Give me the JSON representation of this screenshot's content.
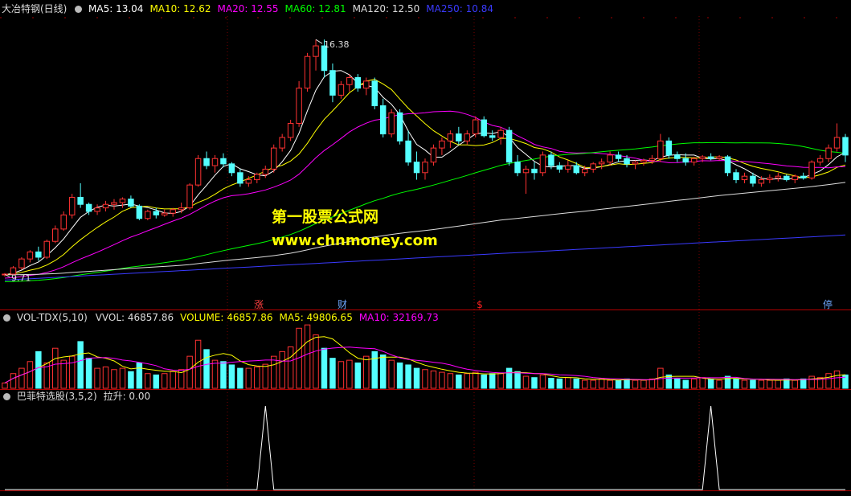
{
  "main_panel": {
    "title": "大冶特钢(日线)",
    "ma": [
      {
        "label": "MA5: 13.04",
        "color": "#ffffff"
      },
      {
        "label": "MA10: 12.62",
        "color": "#ffff00"
      },
      {
        "label": "MA20: 12.55",
        "color": "#ff00ff"
      },
      {
        "label": "MA60: 12.81",
        "color": "#00ff00"
      },
      {
        "label": "MA120: 12.50",
        "color": "#dddddd"
      },
      {
        "label": "MA250: 10.84",
        "color": "#3a3aff"
      }
    ],
    "high_label": "16.38",
    "low_label": "9.71",
    "markers": [
      {
        "text": "涨",
        "color": "#ff4040"
      },
      {
        "text": "财",
        "color": "#6fa8ff"
      },
      {
        "text": "$",
        "color": "#ff2020"
      },
      {
        "text": "停",
        "color": "#6fa8ff"
      }
    ]
  },
  "volume_panel": {
    "name": "VOL-TDX(5,10)",
    "labels": [
      {
        "text": "VVOL: 46857.86",
        "color": "#dddddd"
      },
      {
        "text": "VOLUME: 46857.86",
        "color": "#ffff00"
      },
      {
        "text": "MA5: 49806.65",
        "color": "#ffff00"
      },
      {
        "text": "MA10: 32169.73",
        "color": "#ff00ff"
      }
    ]
  },
  "indicator_panel": {
    "name": "巴菲特选股(3,5,2)",
    "value_label": "拉升: 0.00"
  },
  "watermark": {
    "line1": "第一股票公式网",
    "line2": "www.chnmoney.com"
  },
  "colors": {
    "up": "#ff3232",
    "down": "#54ffff",
    "ma5": "#ffffff",
    "ma10": "#ffff00",
    "ma20": "#ff00ff",
    "ma60": "#00ff00",
    "ma120": "#dddddd",
    "ma250": "#3a3aff",
    "separator": "#b00000"
  },
  "chart_data": {
    "type": "candlestick",
    "price_range": [
      9.4,
      17.0
    ],
    "candles": [
      [
        9.71,
        9.75,
        9.65,
        9.72
      ],
      [
        9.72,
        9.95,
        9.7,
        9.9
      ],
      [
        9.9,
        10.2,
        9.85,
        10.15
      ],
      [
        10.15,
        10.4,
        10.05,
        10.35
      ],
      [
        10.35,
        10.5,
        10.1,
        10.2
      ],
      [
        10.2,
        10.7,
        10.15,
        10.65
      ],
      [
        10.65,
        11.1,
        10.6,
        11.0
      ],
      [
        11.0,
        11.5,
        10.95,
        11.4
      ],
      [
        11.4,
        12.0,
        11.3,
        11.9
      ],
      [
        11.9,
        12.3,
        11.6,
        11.7
      ],
      [
        11.7,
        11.75,
        11.4,
        11.5
      ],
      [
        11.5,
        11.7,
        11.4,
        11.6
      ],
      [
        11.6,
        11.8,
        11.5,
        11.7
      ],
      [
        11.7,
        11.85,
        11.55,
        11.75
      ],
      [
        11.75,
        11.9,
        11.6,
        11.85
      ],
      [
        11.85,
        11.95,
        11.6,
        11.65
      ],
      [
        11.65,
        11.7,
        11.25,
        11.3
      ],
      [
        11.3,
        11.55,
        11.25,
        11.5
      ],
      [
        11.5,
        11.6,
        11.3,
        11.4
      ],
      [
        11.4,
        11.55,
        11.35,
        11.45
      ],
      [
        11.45,
        11.6,
        11.35,
        11.55
      ],
      [
        11.55,
        11.75,
        11.45,
        11.6
      ],
      [
        11.6,
        12.3,
        11.55,
        12.25
      ],
      [
        12.25,
        13.1,
        12.2,
        13.0
      ],
      [
        13.0,
        13.2,
        12.7,
        12.8
      ],
      [
        12.8,
        13.1,
        12.6,
        13.0
      ],
      [
        13.0,
        13.15,
        12.75,
        12.85
      ],
      [
        12.85,
        12.9,
        12.5,
        12.6
      ],
      [
        12.6,
        12.7,
        12.2,
        12.3
      ],
      [
        12.3,
        12.5,
        12.2,
        12.4
      ],
      [
        12.4,
        12.6,
        12.3,
        12.55
      ],
      [
        12.55,
        12.8,
        12.45,
        12.7
      ],
      [
        12.7,
        13.4,
        12.6,
        13.3
      ],
      [
        13.3,
        13.7,
        13.2,
        13.6
      ],
      [
        13.6,
        14.1,
        13.5,
        14.0
      ],
      [
        14.0,
        15.2,
        13.9,
        15.0
      ],
      [
        15.0,
        16.0,
        14.9,
        15.9
      ],
      [
        15.9,
        16.38,
        15.5,
        16.2
      ],
      [
        16.2,
        16.38,
        15.3,
        15.5
      ],
      [
        15.5,
        15.7,
        14.6,
        14.8
      ],
      [
        14.8,
        15.2,
        14.7,
        15.1
      ],
      [
        15.1,
        15.4,
        14.9,
        15.3
      ],
      [
        15.3,
        15.4,
        14.9,
        15.0
      ],
      [
        15.0,
        15.3,
        14.8,
        15.2
      ],
      [
        15.2,
        15.3,
        14.4,
        14.5
      ],
      [
        14.5,
        14.7,
        13.6,
        13.7
      ],
      [
        13.7,
        14.4,
        13.6,
        14.3
      ],
      [
        14.3,
        14.4,
        13.4,
        13.5
      ],
      [
        13.5,
        13.8,
        12.8,
        12.9
      ],
      [
        12.9,
        13.2,
        12.4,
        12.6
      ],
      [
        12.6,
        13.0,
        12.4,
        12.9
      ],
      [
        12.9,
        13.4,
        12.8,
        13.3
      ],
      [
        13.3,
        13.6,
        13.1,
        13.5
      ],
      [
        13.5,
        13.8,
        13.3,
        13.7
      ],
      [
        13.7,
        13.9,
        13.4,
        13.5
      ],
      [
        13.5,
        13.8,
        13.4,
        13.7
      ],
      [
        13.7,
        14.2,
        13.6,
        14.1
      ],
      [
        14.1,
        14.2,
        13.6,
        13.65
      ],
      [
        13.65,
        13.8,
        13.5,
        13.6
      ],
      [
        13.6,
        13.9,
        13.4,
        13.8
      ],
      [
        13.8,
        13.9,
        12.8,
        12.9
      ],
      [
        12.9,
        13.1,
        12.5,
        12.6
      ],
      [
        12.6,
        12.8,
        12.0,
        12.7
      ],
      [
        12.7,
        12.9,
        12.4,
        12.6
      ],
      [
        12.6,
        13.2,
        12.5,
        13.1
      ],
      [
        13.1,
        13.2,
        12.7,
        12.8
      ],
      [
        12.8,
        12.9,
        12.6,
        12.7
      ],
      [
        12.7,
        12.95,
        12.6,
        12.8
      ],
      [
        12.8,
        12.9,
        12.55,
        12.6
      ],
      [
        12.6,
        12.8,
        12.5,
        12.7
      ],
      [
        12.7,
        12.9,
        12.6,
        12.85
      ],
      [
        12.85,
        13.0,
        12.7,
        12.9
      ],
      [
        12.9,
        13.2,
        12.8,
        13.1
      ],
      [
        13.1,
        13.2,
        12.9,
        13.0
      ],
      [
        13.0,
        13.1,
        12.75,
        12.85
      ],
      [
        12.85,
        12.95,
        12.7,
        12.9
      ],
      [
        12.9,
        13.0,
        12.8,
        12.95
      ],
      [
        12.95,
        13.1,
        12.85,
        13.0
      ],
      [
        13.0,
        13.7,
        12.9,
        13.5
      ],
      [
        13.5,
        13.6,
        13.0,
        13.1
      ],
      [
        13.1,
        13.2,
        12.9,
        13.0
      ],
      [
        13.0,
        13.15,
        12.8,
        12.9
      ],
      [
        12.9,
        13.05,
        12.8,
        13.0
      ],
      [
        13.0,
        13.1,
        12.9,
        13.05
      ],
      [
        13.05,
        13.15,
        12.95,
        13.0
      ],
      [
        13.0,
        13.1,
        12.95,
        13.05
      ],
      [
        13.05,
        13.1,
        12.5,
        12.6
      ],
      [
        12.6,
        12.7,
        12.3,
        12.4
      ],
      [
        12.4,
        12.6,
        12.3,
        12.5
      ],
      [
        12.5,
        12.6,
        12.2,
        12.3
      ],
      [
        12.3,
        12.5,
        12.2,
        12.4
      ],
      [
        12.4,
        12.55,
        12.3,
        12.45
      ],
      [
        12.45,
        12.6,
        12.35,
        12.5
      ],
      [
        12.5,
        12.55,
        12.35,
        12.4
      ],
      [
        12.4,
        12.55,
        12.3,
        12.5
      ],
      [
        12.5,
        12.6,
        12.4,
        12.45
      ],
      [
        12.45,
        12.95,
        12.4,
        12.9
      ],
      [
        12.9,
        13.1,
        12.8,
        13.0
      ],
      [
        13.0,
        13.4,
        12.9,
        13.3
      ],
      [
        13.3,
        14.0,
        13.2,
        13.6
      ],
      [
        13.6,
        13.7,
        12.9,
        13.1
      ]
    ],
    "volume_range": [
      0,
      100
    ],
    "volume": [
      8,
      22,
      30,
      40,
      55,
      38,
      60,
      42,
      48,
      70,
      45,
      30,
      32,
      28,
      30,
      25,
      38,
      22,
      20,
      22,
      25,
      28,
      48,
      72,
      58,
      42,
      40,
      35,
      30,
      30,
      32,
      36,
      48,
      55,
      62,
      90,
      95,
      80,
      60,
      45,
      40,
      42,
      38,
      48,
      55,
      50,
      42,
      38,
      35,
      30,
      28,
      26,
      24,
      22,
      20,
      22,
      24,
      20,
      22,
      22,
      30,
      25,
      18,
      16,
      20,
      15,
      14,
      16,
      14,
      12,
      12,
      14,
      12,
      12,
      14,
      12,
      12,
      14,
      30,
      20,
      14,
      12,
      14,
      16,
      14,
      12,
      18,
      14,
      12,
      12,
      12,
      12,
      12,
      14,
      12,
      14,
      18,
      16,
      22,
      26,
      20
    ],
    "volume_up": [
      1,
      1,
      1,
      1,
      0,
      1,
      1,
      1,
      1,
      0,
      0,
      1,
      1,
      1,
      1,
      0,
      0,
      1,
      0,
      1,
      1,
      1,
      1,
      1,
      0,
      1,
      0,
      0,
      0,
      1,
      1,
      1,
      1,
      1,
      1,
      1,
      1,
      1,
      0,
      0,
      1,
      1,
      0,
      1,
      0,
      0,
      1,
      0,
      0,
      0,
      1,
      1,
      1,
      1,
      0,
      1,
      1,
      0,
      0,
      1,
      0,
      0,
      1,
      0,
      1,
      0,
      0,
      1,
      0,
      1,
      1,
      1,
      1,
      0,
      0,
      1,
      1,
      1,
      1,
      0,
      0,
      0,
      1,
      1,
      0,
      1,
      0,
      0,
      1,
      0,
      1,
      1,
      1,
      0,
      1,
      0,
      1,
      1,
      1,
      1,
      0
    ],
    "indicator_range": [
      0,
      100
    ],
    "indicator": [
      0,
      0,
      0,
      0,
      0,
      0,
      0,
      0,
      0,
      0,
      0,
      0,
      0,
      0,
      0,
      0,
      0,
      0,
      0,
      0,
      0,
      0,
      0,
      0,
      0,
      0,
      0,
      0,
      0,
      0,
      0,
      0,
      0,
      0,
      0,
      0,
      0,
      0,
      0,
      0,
      0,
      0,
      0,
      0,
      0,
      0,
      0,
      0,
      0,
      0,
      0,
      0,
      0,
      0,
      0,
      0,
      0,
      0,
      0,
      0,
      0,
      0,
      0,
      0,
      0,
      0,
      0,
      0,
      0,
      0,
      0,
      0,
      0,
      0,
      0,
      0,
      0,
      0,
      0,
      0,
      0,
      0,
      0,
      0,
      0,
      0,
      0,
      0,
      0,
      0,
      0,
      0,
      0,
      0,
      0,
      0,
      0,
      0,
      0,
      0,
      0
    ],
    "indicator_spikes": [
      {
        "index": 31,
        "value": 100
      },
      {
        "index": 84,
        "value": 100
      }
    ]
  }
}
